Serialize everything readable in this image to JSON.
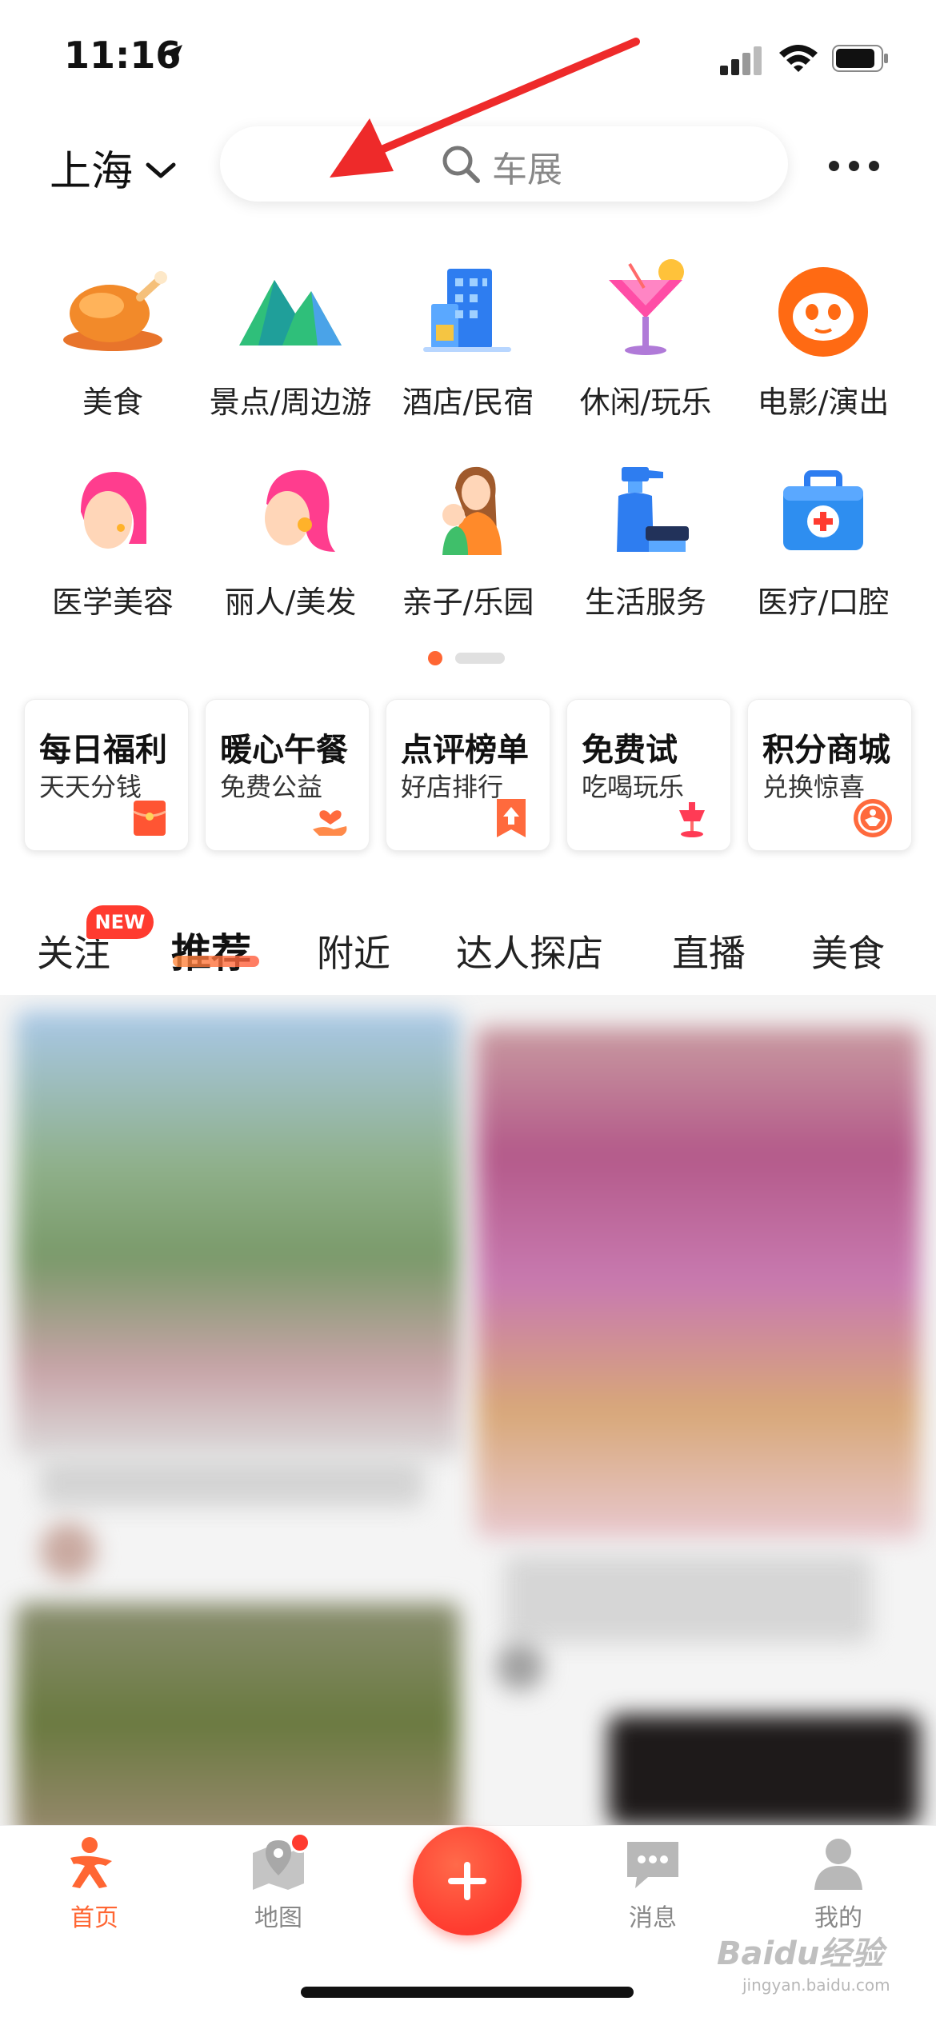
{
  "status_bar": {
    "time": "11:16",
    "location_icon": "location-arrow-icon",
    "signal_icon": "cellular-signal-icon",
    "wifi_icon": "wifi-icon",
    "battery_icon": "battery-icon"
  },
  "header": {
    "city": "上海",
    "search_placeholder": "车展"
  },
  "categories": [
    {
      "label": "美食",
      "icon": "roast-chicken-icon"
    },
    {
      "label": "景点/周边游",
      "icon": "mountain-icon"
    },
    {
      "label": "酒店/民宿",
      "icon": "hotel-building-icon"
    },
    {
      "label": "休闲/玩乐",
      "icon": "cocktail-icon"
    },
    {
      "label": "电影/演出",
      "icon": "cat-face-icon"
    },
    {
      "label": "医学美容",
      "icon": "woman-face-icon"
    },
    {
      "label": "丽人/美发",
      "icon": "woman-hair-icon"
    },
    {
      "label": "亲子/乐园",
      "icon": "mother-child-icon"
    },
    {
      "label": "生活服务",
      "icon": "spray-bottle-icon"
    },
    {
      "label": "医疗/口腔",
      "icon": "medical-kit-icon"
    }
  ],
  "promos": [
    {
      "title": "每日福利",
      "subtitle": "天天分钱",
      "icon": "red-envelope-icon"
    },
    {
      "title": "暖心午餐",
      "subtitle": "免费公益",
      "icon": "heart-hand-icon"
    },
    {
      "title": "点评榜单",
      "subtitle": "好店排行",
      "icon": "ranking-bookmark-icon"
    },
    {
      "title": "免费试",
      "subtitle": "吃喝玩乐",
      "icon": "dessert-stand-icon"
    },
    {
      "title": "积分商城",
      "subtitle": "兑换惊喜",
      "icon": "points-mall-icon"
    }
  ],
  "feed_tabs": [
    {
      "label": "关注",
      "badge": "NEW"
    },
    {
      "label": "推荐",
      "active": true
    },
    {
      "label": "附近"
    },
    {
      "label": "达人探店"
    },
    {
      "label": "直播"
    },
    {
      "label": "美食"
    }
  ],
  "bottom_nav": [
    {
      "label": "首页",
      "icon": "home-person-icon",
      "active": true
    },
    {
      "label": "地图",
      "icon": "map-pin-icon",
      "has_dot": true
    },
    {
      "label": "消息",
      "icon": "chat-bubble-icon"
    },
    {
      "label": "我的",
      "icon": "user-profile-icon"
    }
  ],
  "watermark": {
    "main": "Baidu经验",
    "sub": "jingyan.baidu.com"
  },
  "colors": {
    "accent": "#ff6633",
    "badge_red": "#ff3b2f",
    "plus_button": "#ff3b2f"
  }
}
